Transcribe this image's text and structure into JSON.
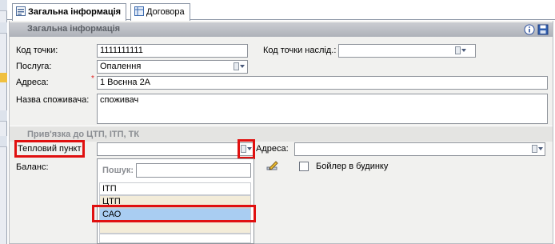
{
  "tabs": [
    {
      "label": "Загальна інформація",
      "icon": "form-icon",
      "active": true
    },
    {
      "label": "Договора",
      "icon": "table-icon",
      "active": false
    }
  ],
  "general": {
    "header": "Загальна інформація",
    "code_label": "Код точки:",
    "code_value": "1111111111",
    "next_code_label": "Код точки наслід.:",
    "next_code_value": "",
    "service_label": "Послуга:",
    "service_value": "Опалення",
    "address_label": "Адреса:",
    "address_value": "1 Воєнна 2А",
    "consumer_label": "Назва споживача:",
    "consumer_value": "споживач"
  },
  "binding": {
    "header": "Прив'язка до ЦТП, ІТП, ТК",
    "heat_point_label": "Тепловий пункт",
    "heat_point_value": "",
    "address_label": "Адреса:",
    "address_value": "",
    "balance_label": "Баланс:",
    "search_label": "Пошук:",
    "search_value": "",
    "boiler_label": "Бойлер в будинку",
    "boiler_checked": false,
    "options": [
      "ІТП",
      "ЦТП",
      "САО"
    ],
    "selected_option": "САО"
  },
  "colors": {
    "highlight_red": "#e01010",
    "selected_row": "#a9cdf2",
    "header_bg": "#b9bcc3"
  }
}
